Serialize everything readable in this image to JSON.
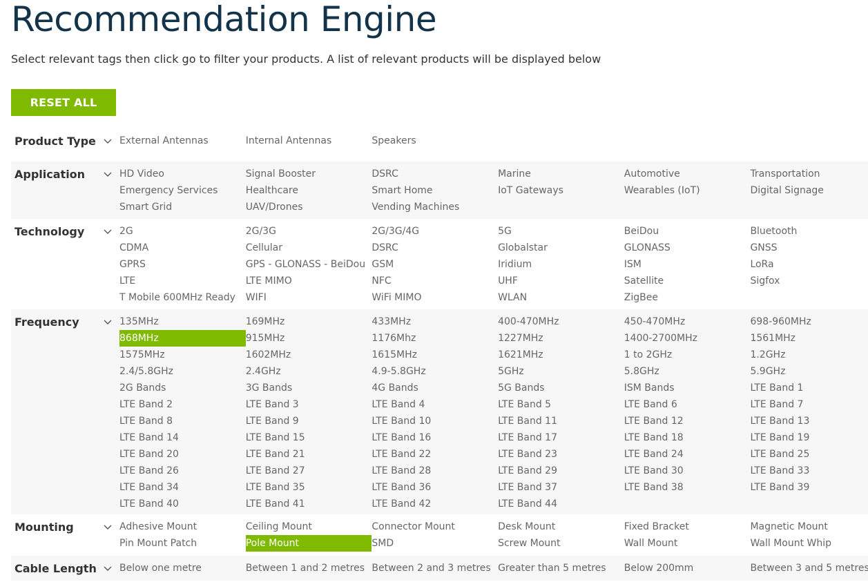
{
  "header": {
    "title": "Recommendation Engine",
    "subtitle": "Select relevant tags then click go to filter your products. A list of relevant products will be displayed below"
  },
  "reset_button": {
    "label": "RESET ALL"
  },
  "colors": {
    "accent": "#7fba00",
    "title": "#12334a",
    "label": "#333333",
    "tag": "#666666",
    "row_shade": "#f7f7f7"
  },
  "icons": {
    "row_toggle": "chevron-down-icon"
  },
  "filters": [
    {
      "id": "product-type",
      "label": "Product Type",
      "shaded": false,
      "tags": [
        {
          "label": "External Antennas",
          "selected": false
        },
        {
          "label": "Internal Antennas",
          "selected": false
        },
        {
          "label": "Speakers",
          "selected": false
        }
      ]
    },
    {
      "id": "application",
      "label": "Application",
      "shaded": true,
      "tags": [
        {
          "label": "HD Video",
          "selected": false
        },
        {
          "label": "Signal Booster",
          "selected": false
        },
        {
          "label": "DSRC",
          "selected": false
        },
        {
          "label": "Marine",
          "selected": false
        },
        {
          "label": "Automotive",
          "selected": false
        },
        {
          "label": "Transportation",
          "selected": false
        },
        {
          "label": "Emergency Services",
          "selected": false
        },
        {
          "label": "Healthcare",
          "selected": false
        },
        {
          "label": "Smart Home",
          "selected": false
        },
        {
          "label": "IoT Gateways",
          "selected": false
        },
        {
          "label": "Wearables (IoT)",
          "selected": false
        },
        {
          "label": "Digital Signage",
          "selected": false
        },
        {
          "label": "Smart Grid",
          "selected": false
        },
        {
          "label": "UAV/Drones",
          "selected": false
        },
        {
          "label": "Vending Machines",
          "selected": false
        }
      ]
    },
    {
      "id": "technology",
      "label": "Technology",
      "shaded": false,
      "tags": [
        {
          "label": "2G",
          "selected": false
        },
        {
          "label": "2G/3G",
          "selected": false
        },
        {
          "label": "2G/3G/4G",
          "selected": false
        },
        {
          "label": "5G",
          "selected": false
        },
        {
          "label": "BeiDou",
          "selected": false
        },
        {
          "label": "Bluetooth",
          "selected": false
        },
        {
          "label": "CDMA",
          "selected": false
        },
        {
          "label": "Cellular",
          "selected": false
        },
        {
          "label": "DSRC",
          "selected": false
        },
        {
          "label": "Globalstar",
          "selected": false
        },
        {
          "label": "GLONASS",
          "selected": false
        },
        {
          "label": "GNSS",
          "selected": false
        },
        {
          "label": "GPRS",
          "selected": false
        },
        {
          "label": "GPS - GLONASS - BeiDou",
          "selected": false
        },
        {
          "label": "GSM",
          "selected": false
        },
        {
          "label": "Iridium",
          "selected": false
        },
        {
          "label": "ISM",
          "selected": false
        },
        {
          "label": "LoRa",
          "selected": false
        },
        {
          "label": "LTE",
          "selected": false
        },
        {
          "label": "LTE MIMO",
          "selected": false
        },
        {
          "label": "NFC",
          "selected": false
        },
        {
          "label": "UHF",
          "selected": false
        },
        {
          "label": "Satellite",
          "selected": false
        },
        {
          "label": "Sigfox",
          "selected": false
        },
        {
          "label": "T Mobile 600MHz Ready",
          "selected": false
        },
        {
          "label": "WIFI",
          "selected": false
        },
        {
          "label": "WiFi MIMO",
          "selected": false
        },
        {
          "label": "WLAN",
          "selected": false
        },
        {
          "label": "ZigBee",
          "selected": false
        }
      ]
    },
    {
      "id": "frequency",
      "label": "Frequency",
      "shaded": true,
      "tags": [
        {
          "label": "135MHz",
          "selected": false
        },
        {
          "label": "169MHz",
          "selected": false
        },
        {
          "label": "433MHz",
          "selected": false
        },
        {
          "label": "400-470MHz",
          "selected": false
        },
        {
          "label": "450-470MHz",
          "selected": false
        },
        {
          "label": "698-960MHz",
          "selected": false
        },
        {
          "label": "868MHz",
          "selected": true
        },
        {
          "label": "915MHz",
          "selected": false
        },
        {
          "label": "1176Mhz",
          "selected": false
        },
        {
          "label": "1227MHz",
          "selected": false
        },
        {
          "label": "1400-2700MHz",
          "selected": false
        },
        {
          "label": "1561MHz",
          "selected": false
        },
        {
          "label": "1575MHz",
          "selected": false
        },
        {
          "label": "1602MHz",
          "selected": false
        },
        {
          "label": "1615MHz",
          "selected": false
        },
        {
          "label": "1621MHz",
          "selected": false
        },
        {
          "label": "1 to 2GHz",
          "selected": false
        },
        {
          "label": "1.2GHz",
          "selected": false
        },
        {
          "label": "2.4/5.8GHz",
          "selected": false
        },
        {
          "label": "2.4GHz",
          "selected": false
        },
        {
          "label": "4.9-5.8GHz",
          "selected": false
        },
        {
          "label": "5GHz",
          "selected": false
        },
        {
          "label": "5.8GHz",
          "selected": false
        },
        {
          "label": "5.9GHz",
          "selected": false
        },
        {
          "label": "2G Bands",
          "selected": false
        },
        {
          "label": "3G Bands",
          "selected": false
        },
        {
          "label": "4G Bands",
          "selected": false
        },
        {
          "label": "5G Bands",
          "selected": false
        },
        {
          "label": "ISM Bands",
          "selected": false
        },
        {
          "label": "LTE Band 1",
          "selected": false
        },
        {
          "label": "LTE Band 2",
          "selected": false
        },
        {
          "label": "LTE Band 3",
          "selected": false
        },
        {
          "label": "LTE Band 4",
          "selected": false
        },
        {
          "label": "LTE Band 5",
          "selected": false
        },
        {
          "label": "LTE Band 6",
          "selected": false
        },
        {
          "label": "LTE Band 7",
          "selected": false
        },
        {
          "label": "LTE Band 8",
          "selected": false
        },
        {
          "label": "LTE Band 9",
          "selected": false
        },
        {
          "label": "LTE Band 10",
          "selected": false
        },
        {
          "label": "LTE Band 11",
          "selected": false
        },
        {
          "label": "LTE Band 12",
          "selected": false
        },
        {
          "label": "LTE Band 13",
          "selected": false
        },
        {
          "label": "LTE Band 14",
          "selected": false
        },
        {
          "label": "LTE Band 15",
          "selected": false
        },
        {
          "label": "LTE Band 16",
          "selected": false
        },
        {
          "label": "LTE Band 17",
          "selected": false
        },
        {
          "label": "LTE Band 18",
          "selected": false
        },
        {
          "label": "LTE Band 19",
          "selected": false
        },
        {
          "label": "LTE Band 20",
          "selected": false
        },
        {
          "label": "LTE Band 21",
          "selected": false
        },
        {
          "label": "LTE Band 22",
          "selected": false
        },
        {
          "label": "LTE Band 23",
          "selected": false
        },
        {
          "label": "LTE Band 24",
          "selected": false
        },
        {
          "label": "LTE Band 25",
          "selected": false
        },
        {
          "label": "LTE Band 26",
          "selected": false
        },
        {
          "label": "LTE Band 27",
          "selected": false
        },
        {
          "label": "LTE Band 28",
          "selected": false
        },
        {
          "label": "LTE Band 29",
          "selected": false
        },
        {
          "label": "LTE Band 30",
          "selected": false
        },
        {
          "label": "LTE Band 33",
          "selected": false
        },
        {
          "label": "LTE Band 34",
          "selected": false
        },
        {
          "label": "LTE Band 35",
          "selected": false
        },
        {
          "label": "LTE Band 36",
          "selected": false
        },
        {
          "label": "LTE Band 37",
          "selected": false
        },
        {
          "label": "LTE Band 38",
          "selected": false
        },
        {
          "label": "LTE Band 39",
          "selected": false
        },
        {
          "label": "LTE Band 40",
          "selected": false
        },
        {
          "label": "LTE Band 41",
          "selected": false
        },
        {
          "label": "LTE Band 42",
          "selected": false
        },
        {
          "label": "LTE Band 44",
          "selected": false
        }
      ]
    },
    {
      "id": "mounting",
      "label": "Mounting",
      "shaded": false,
      "tags": [
        {
          "label": "Adhesive Mount",
          "selected": false
        },
        {
          "label": "Ceiling Mount",
          "selected": false
        },
        {
          "label": "Connector Mount",
          "selected": false
        },
        {
          "label": "Desk Mount",
          "selected": false
        },
        {
          "label": "Fixed Bracket",
          "selected": false
        },
        {
          "label": "Magnetic Mount",
          "selected": false
        },
        {
          "label": "Pin Mount Patch",
          "selected": false
        },
        {
          "label": "Pole Mount",
          "selected": true
        },
        {
          "label": "SMD",
          "selected": false
        },
        {
          "label": "Screw Mount",
          "selected": false
        },
        {
          "label": "Wall Mount",
          "selected": false
        },
        {
          "label": "Wall Mount Whip",
          "selected": false
        }
      ]
    },
    {
      "id": "cable-length",
      "label": "Cable Length",
      "shaded": true,
      "tags": [
        {
          "label": "Below one metre",
          "selected": false
        },
        {
          "label": "Between 1 and 2 metres",
          "selected": false
        },
        {
          "label": "Between 2 and 3 metres",
          "selected": false
        },
        {
          "label": "Greater than 5 metres",
          "selected": false
        },
        {
          "label": "Below 200mm",
          "selected": false
        },
        {
          "label": "Between 3 and 5 metres",
          "selected": false
        }
      ]
    }
  ]
}
